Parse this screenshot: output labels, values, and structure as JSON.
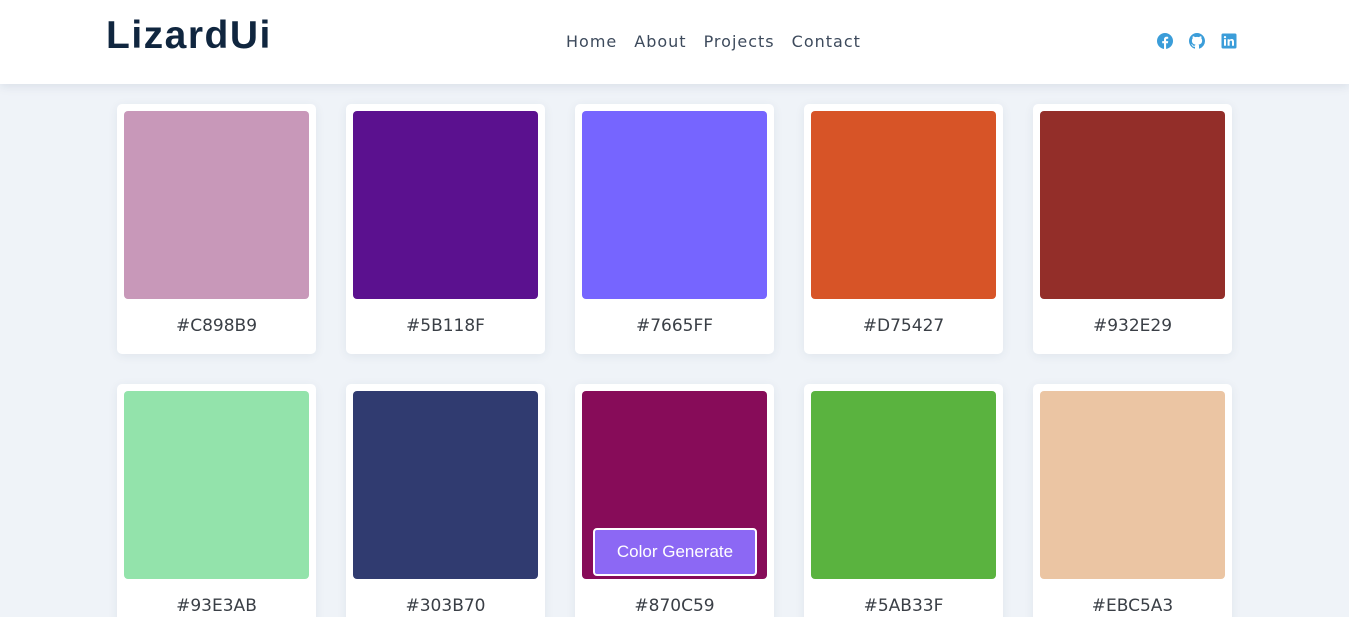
{
  "header": {
    "logo": "LizardUi",
    "nav": [
      "Home",
      "About",
      "Projects",
      "Contact"
    ],
    "social": [
      {
        "icon": "facebook-icon",
        "color": "#3b9dd9"
      },
      {
        "icon": "github-icon",
        "color": "#3b9dd9"
      },
      {
        "icon": "linkedin-icon",
        "color": "#3b9dd9"
      }
    ]
  },
  "colors": [
    "#C898B9",
    "#5B118F",
    "#7665FF",
    "#D75427",
    "#932E29",
    "#93E3AB",
    "#303B70",
    "#870C59",
    "#5AB33F",
    "#EBC5A3"
  ],
  "generate_button": "Color Generate",
  "theme": {
    "background": "#eff3f8",
    "logo_color": "#10263f",
    "button_color": "#8c68f4"
  }
}
